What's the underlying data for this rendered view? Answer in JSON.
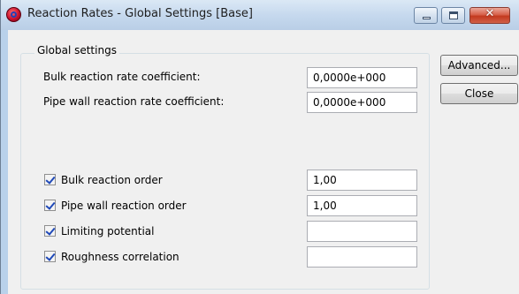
{
  "window": {
    "title": "Reaction Rates - Global Settings [Base]",
    "close_glyph": "✕"
  },
  "group": {
    "title": "Global settings"
  },
  "fields": {
    "bulk_coeff_label": "Bulk reaction rate coefficient:",
    "bulk_coeff_value": "0,0000e+000",
    "wall_coeff_label": "Pipe wall reaction rate coefficient:",
    "wall_coeff_value": "0,0000e+000"
  },
  "options": {
    "bulk_order": {
      "label": "Bulk reaction order",
      "checked": true,
      "value": "1,00"
    },
    "wall_order": {
      "label": "Pipe wall reaction order",
      "checked": true,
      "value": "1,00"
    },
    "limiting_potential": {
      "label": "Limiting potential",
      "checked": true,
      "value": ""
    },
    "roughness_correlation": {
      "label": "Roughness correlation",
      "checked": true,
      "value": ""
    }
  },
  "buttons": {
    "advanced_label": "Advanced...",
    "close_label": "Close"
  }
}
